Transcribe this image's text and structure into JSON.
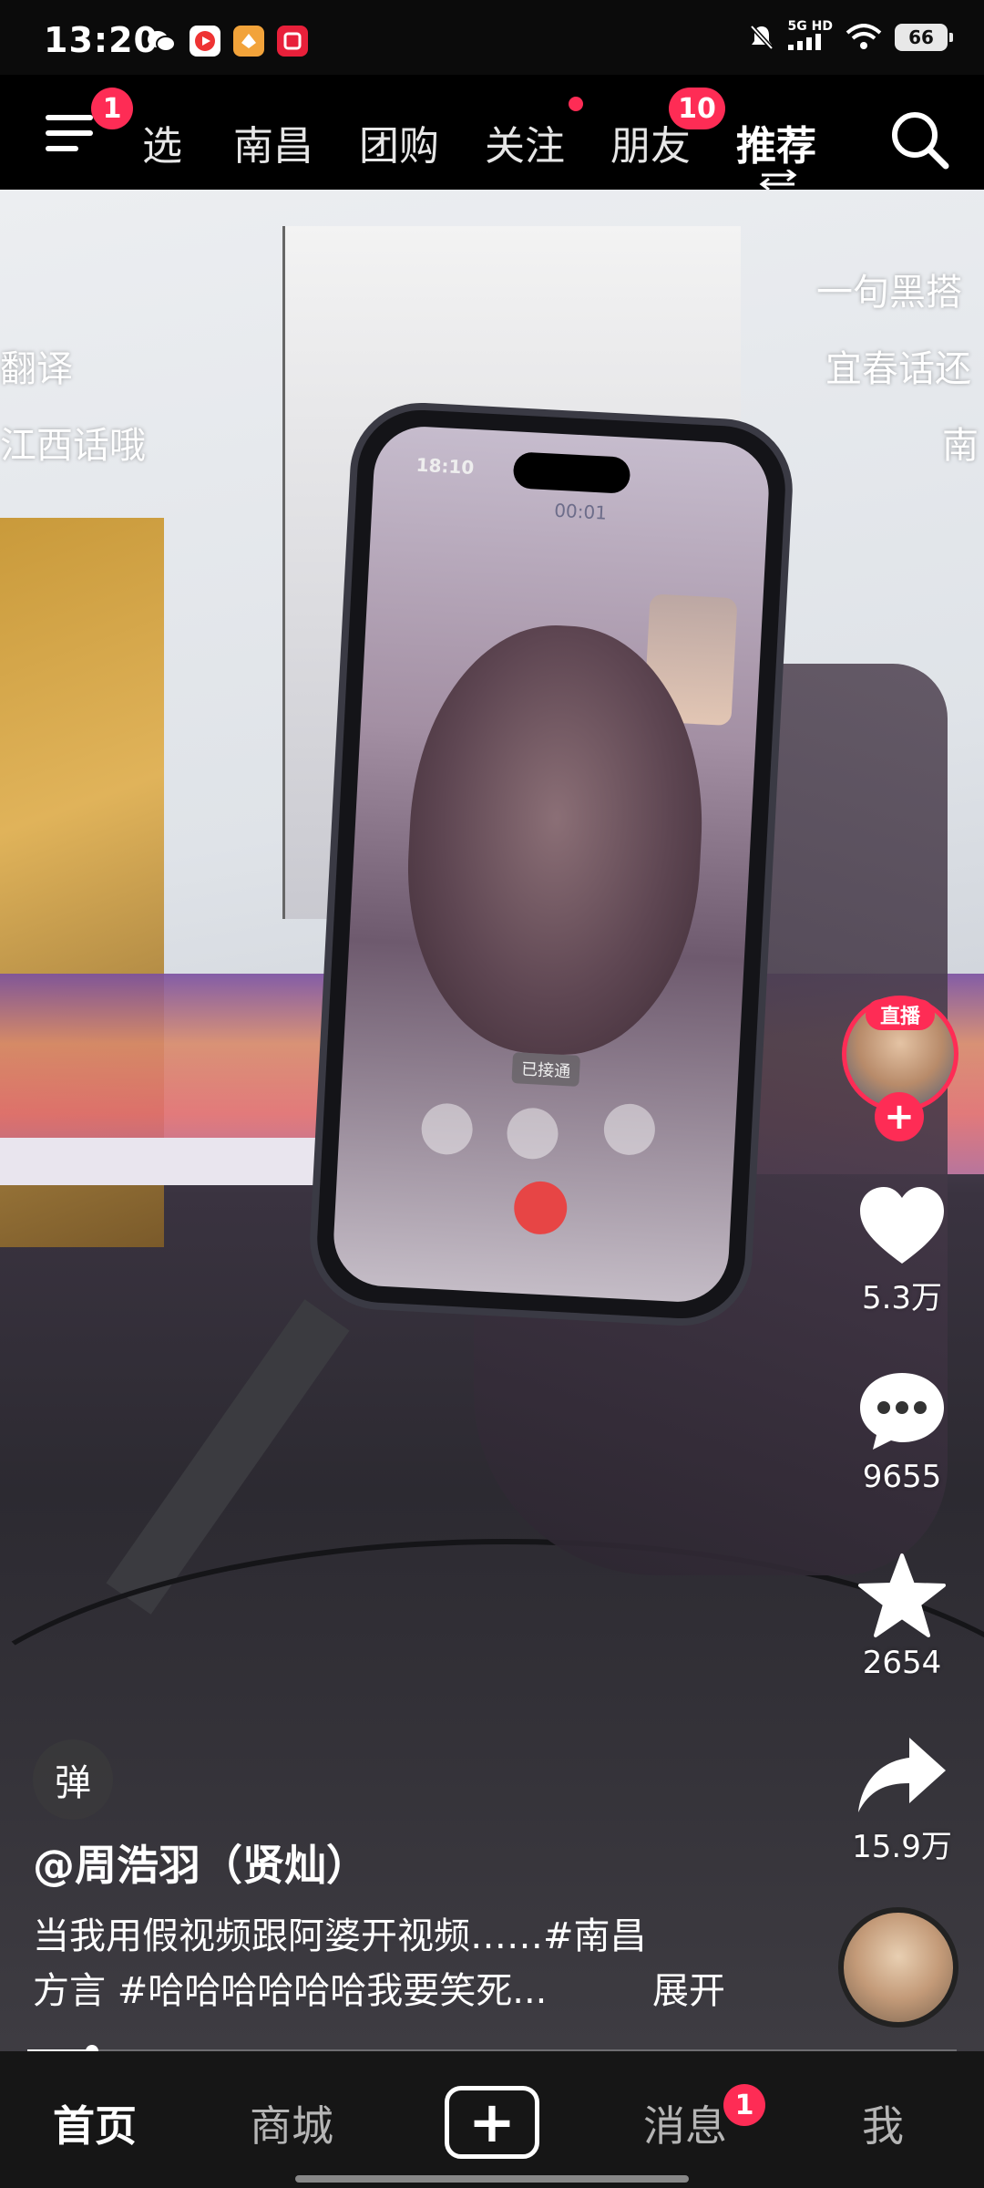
{
  "status_bar": {
    "time": "13:20",
    "network_top": "5G HD",
    "battery": "66"
  },
  "top_nav": {
    "menu_badge": "1",
    "tabs": [
      {
        "label": "选"
      },
      {
        "label": "南昌"
      },
      {
        "label": "团购"
      },
      {
        "label": "关注"
      },
      {
        "label": "朋友",
        "badge": "10"
      },
      {
        "label": "推荐"
      }
    ],
    "active_tab": "推荐"
  },
  "video": {
    "captions_left": [
      "翻译",
      "江西话哦"
    ],
    "captions_right": [
      "一句黑搭",
      "宜春话还",
      "南"
    ],
    "phone_time": "18:10",
    "call_timer": "00:01",
    "call_status": "已接通"
  },
  "actions": {
    "live_label": "直播",
    "likes": "5.3万",
    "comments": "9655",
    "favorites": "2654",
    "shares": "15.9万"
  },
  "post": {
    "danmu_label": "弹",
    "author": "@周浩羽（贤灿）",
    "description_line1": "当我用假视频跟阿婆开视频……#南昌",
    "description_line2": "方言 #哈哈哈哈哈哈我要笑死...",
    "expand_label": "展开",
    "progress": 0.07
  },
  "bottom_tabs": {
    "home": "首页",
    "mall": "商城",
    "messages": "消息",
    "messages_badge": "1",
    "me": "我"
  },
  "colors": {
    "accent": "#fe2c55",
    "tabbar_bg": "#161616"
  }
}
